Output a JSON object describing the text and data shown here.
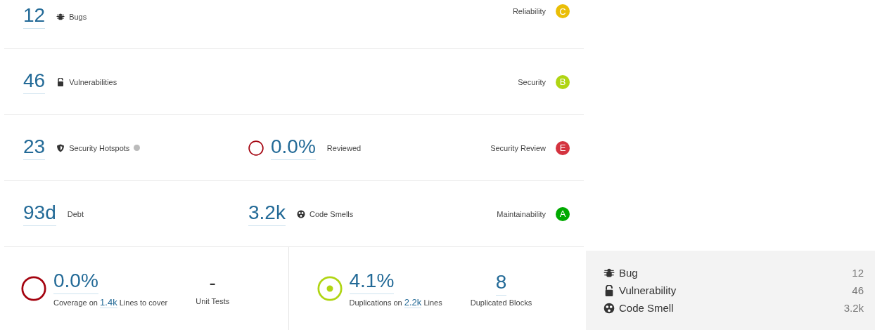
{
  "measures": [
    {
      "value": "12",
      "label": "Bugs",
      "help": false,
      "rating": {
        "label": "Reliability",
        "grade": "C",
        "color": "#eabe06"
      }
    },
    {
      "value": "46",
      "label": "Vulnerabilities",
      "help": false,
      "rating": {
        "label": "Security",
        "grade": "B",
        "color": "#b0d513"
      }
    },
    {
      "value": "23",
      "label": "Security Hotspots",
      "help": true,
      "middle": {
        "kind": "ring",
        "value": "0.0%",
        "label": "Reviewed"
      },
      "rating": {
        "label": "Security Review",
        "grade": "E",
        "color": "#d4333f"
      }
    },
    {
      "value": "93d",
      "label": "Debt",
      "help": false,
      "middle": {
        "kind": "icon",
        "value": "3.2k",
        "label": "Code Smells"
      },
      "rating": {
        "label": "Maintainability",
        "grade": "A",
        "color": "#00aa00"
      }
    }
  ],
  "coverage": [
    {
      "value": "0.0%",
      "caption_before": "Coverage on",
      "caption_value": "1.4k",
      "caption_after": "Lines to cover",
      "stat_value": "-",
      "stat_label": "Unit Tests"
    },
    {
      "value": "4.1%",
      "caption_before": "Duplications on",
      "caption_value": "2.2k",
      "caption_after": "Lines",
      "stat_value": "8",
      "stat_label": "Duplicated Blocks"
    }
  ],
  "issue_types": [
    {
      "label": "Bug",
      "count": "12"
    },
    {
      "label": "Vulnerability",
      "count": "46"
    },
    {
      "label": "Code Smell",
      "count": "3.2k"
    }
  ]
}
